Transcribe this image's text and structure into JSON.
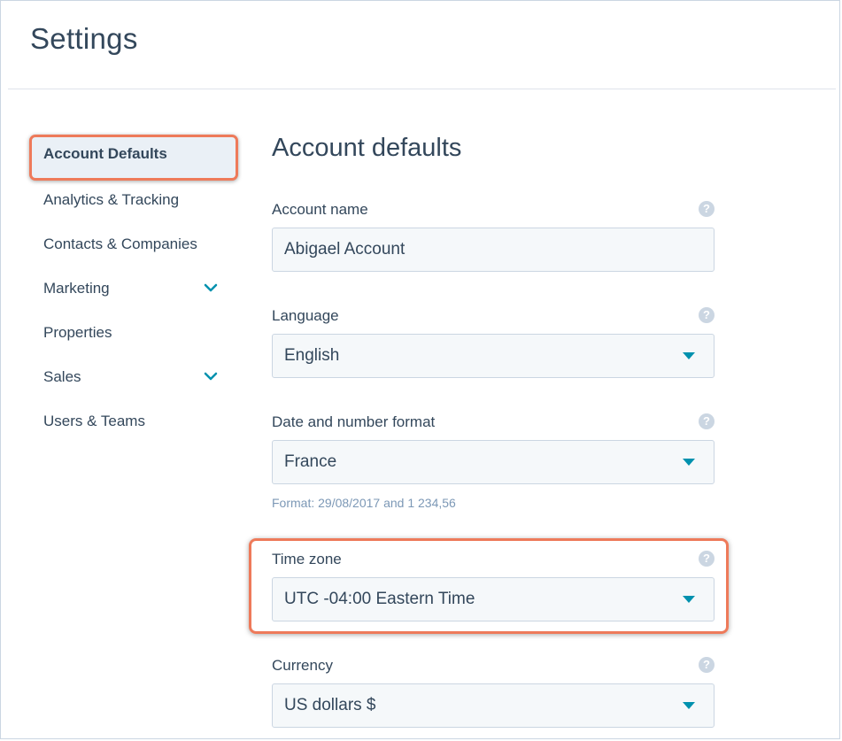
{
  "page": {
    "title": "Settings"
  },
  "sidebar": {
    "items": [
      {
        "label": "Account Defaults",
        "active": true
      },
      {
        "label": "Analytics & Tracking"
      },
      {
        "label": "Contacts & Companies"
      },
      {
        "label": "Marketing",
        "icon": "chevron-down-icon"
      },
      {
        "label": "Properties"
      },
      {
        "label": "Sales",
        "icon": "chevron-down-icon"
      },
      {
        "label": "Users & Teams"
      }
    ]
  },
  "main": {
    "title": "Account defaults",
    "fields": {
      "account_name": {
        "label": "Account name",
        "value": "Abigael Account",
        "help_icon": "?"
      },
      "language": {
        "label": "Language",
        "value": "English",
        "help_icon": "?"
      },
      "date_format": {
        "label": "Date and number format",
        "value": "France",
        "hint": "Format: 29/08/2017 and 1 234,56",
        "help_icon": "?"
      },
      "time_zone": {
        "label": "Time zone",
        "value": "UTC -04:00 Eastern Time",
        "help_icon": "?"
      },
      "currency": {
        "label": "Currency",
        "value": "US dollars $",
        "help_icon": "?"
      }
    }
  },
  "colors": {
    "accent": "#0091ae",
    "highlight_border": "#ee7a5a",
    "text": "#33475b",
    "input_bg": "#f5f8fa"
  }
}
